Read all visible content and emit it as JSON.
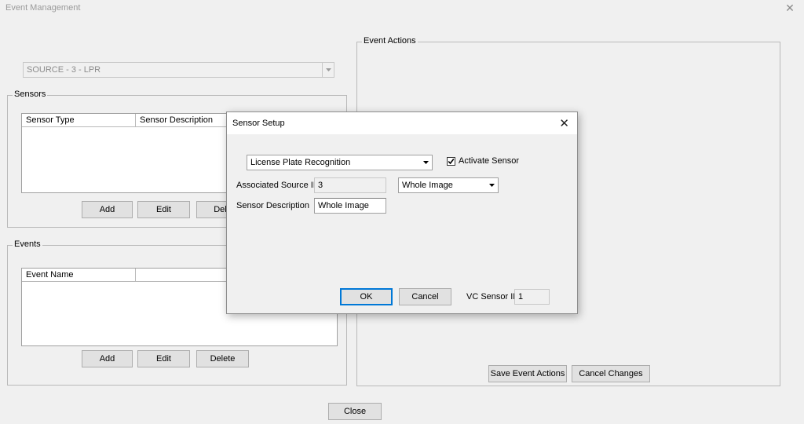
{
  "window": {
    "title": "Event Management",
    "close_glyph": "✕"
  },
  "source_combo": {
    "value": "SOURCE -   3 - LPR"
  },
  "sensors_group": {
    "label": "Sensors",
    "columns": [
      "Sensor Type",
      "Sensor Description"
    ],
    "buttons": {
      "add": "Add",
      "edit": "Edit",
      "delete": "Dele"
    }
  },
  "events_group": {
    "label": "Events",
    "columns": [
      "Event Name"
    ],
    "buttons": {
      "add": "Add",
      "edit": "Edit",
      "delete": "Delete"
    }
  },
  "event_actions_group": {
    "label": "Event Actions",
    "buttons": {
      "save": "Save Event Actions",
      "cancel": "Cancel Changes"
    }
  },
  "close_button": "Close",
  "sensor_setup_dialog": {
    "title": "Sensor Setup",
    "close_glyph": "✕",
    "sensor_type": {
      "value": "License Plate Recognition"
    },
    "activate_sensor": {
      "label": "Activate Sensor",
      "checked": true
    },
    "associated_source_id": {
      "label": "Associated Source ID",
      "value": "3"
    },
    "region": {
      "value": "Whole Image"
    },
    "sensor_description": {
      "label": "Sensor Description",
      "value": "Whole Image"
    },
    "ok_label": "OK",
    "cancel_label": "Cancel",
    "vc_sensor_id": {
      "label": "VC Sensor ID",
      "value": "1"
    }
  },
  "icons": {
    "dropdown": "chevron-down-icon",
    "close": "close-icon",
    "check": "checkmark-icon"
  },
  "colors": {
    "accent": "#0078d7",
    "background": "#f0f0f0"
  }
}
